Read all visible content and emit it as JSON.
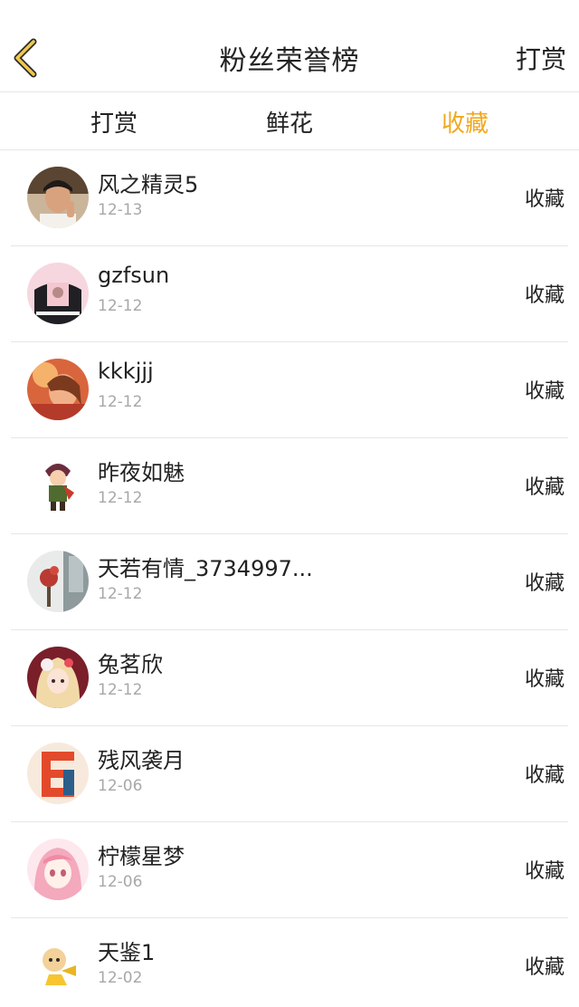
{
  "header": {
    "back_icon": "chevron-left-icon",
    "title": "粉丝荣誉榜",
    "action_label": "打赏",
    "accent_color": "#f2a81d"
  },
  "tabs": [
    {
      "label": "打赏",
      "active": false
    },
    {
      "label": "鲜花",
      "active": false
    },
    {
      "label": "收藏",
      "active": true
    }
  ],
  "fans": [
    {
      "name": "风之精灵5",
      "date": "12-13",
      "type": "收藏"
    },
    {
      "name": "gzfsun",
      "date": "12-12",
      "type": "收藏"
    },
    {
      "name": "kkkjjj",
      "date": "12-12",
      "type": "收藏"
    },
    {
      "name": "昨夜如魅",
      "date": "12-12",
      "type": "收藏"
    },
    {
      "name": "天若有情_3734997...",
      "date": "12-12",
      "type": "收藏"
    },
    {
      "name": "兔茗欣",
      "date": "12-12",
      "type": "收藏"
    },
    {
      "name": "残风袭月",
      "date": "12-06",
      "type": "收藏"
    },
    {
      "name": "柠檬星梦",
      "date": "12-06",
      "type": "收藏"
    },
    {
      "name": "天鉴1",
      "date": "12-02",
      "type": "收藏"
    }
  ]
}
